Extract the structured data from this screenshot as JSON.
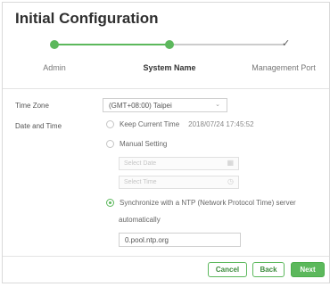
{
  "dialog": {
    "title": "Initial Configuration"
  },
  "steps": [
    {
      "label": "Admin"
    },
    {
      "label": "System Name"
    },
    {
      "label": "Management Port"
    }
  ],
  "form": {
    "timezone_label": "Time Zone",
    "timezone_value": "(GMT+08:00) Taipei",
    "datetime_label": "Date and Time",
    "keep_label": "Keep Current Time",
    "current_time": "2018/07/24 17:45:52",
    "manual_label": "Manual Setting",
    "date_placeholder": "Select Date",
    "time_placeholder": "Select Time",
    "ntp_label": "Synchronize with a NTP (Network Protocol Time) server",
    "ntp_label_cont": "automatically",
    "ntp_server": "0.pool.ntp.org"
  },
  "buttons": {
    "cancel": "Cancel",
    "back": "Back",
    "next": "Next"
  },
  "colors": {
    "accent": "#5cb85c",
    "pending_line": "#cccccc"
  },
  "icons": {
    "calendar": "calendar-icon",
    "clock": "clock-icon",
    "check": "check-icon",
    "caret": "chevron-down-icon"
  }
}
